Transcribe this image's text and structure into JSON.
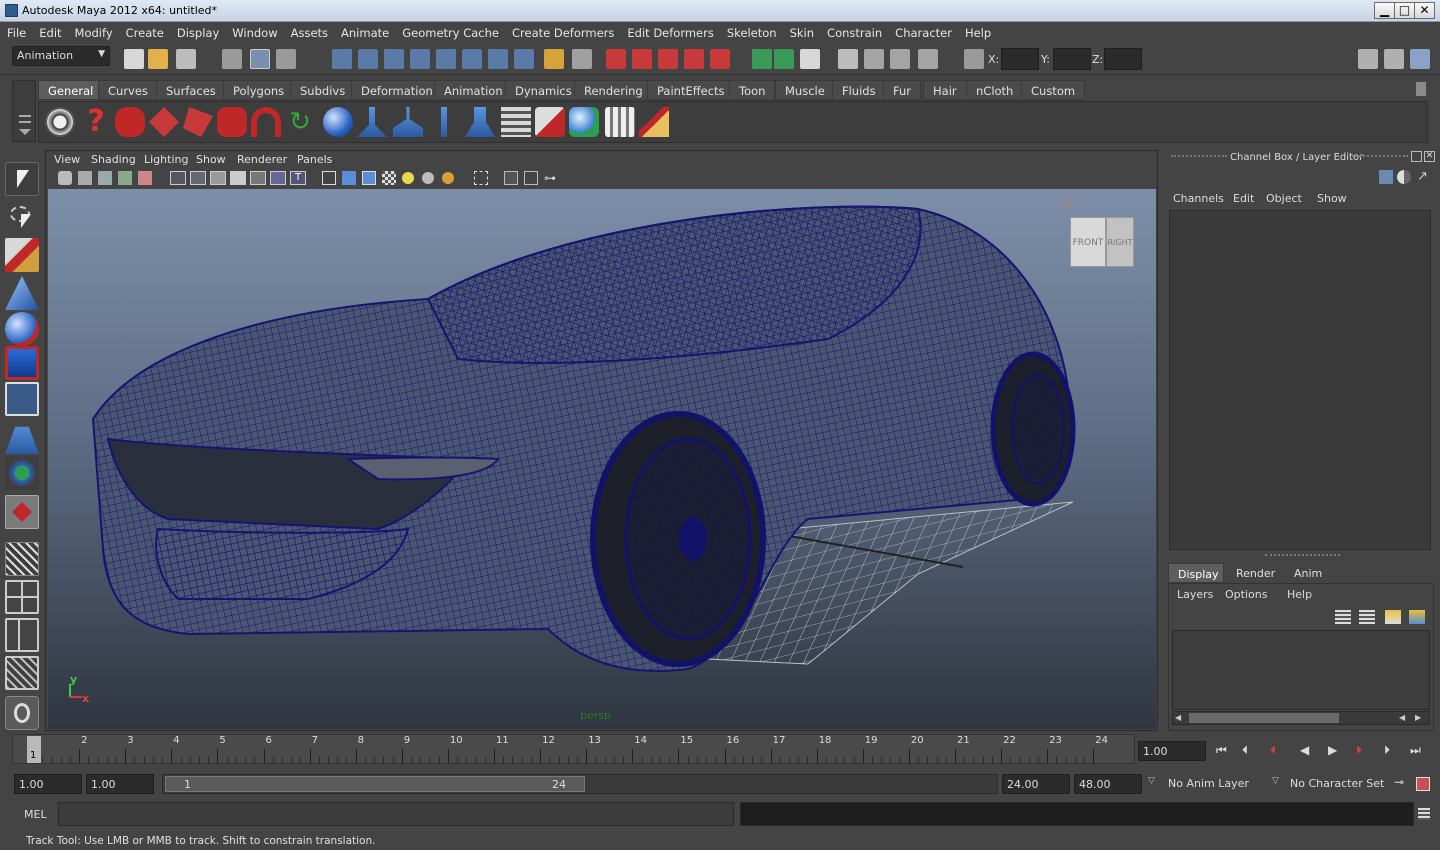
{
  "window": {
    "title": "Autodesk Maya 2012 x64: untitled*",
    "minimize_glyph": "▁",
    "maximize_glyph": "□",
    "close_glyph": "✕"
  },
  "menubar": [
    "File",
    "Edit",
    "Modify",
    "Create",
    "Display",
    "Window",
    "Assets",
    "Animate",
    "Geometry Cache",
    "Create Deformers",
    "Edit Deformers",
    "Skeleton",
    "Skin",
    "Constrain",
    "Character",
    "Help"
  ],
  "statusline": {
    "menuset": "Animation",
    "x_label": "X:",
    "y_label": "Y:",
    "z_label": "Z:"
  },
  "shelf": {
    "tabs": [
      "General",
      "Curves",
      "Surfaces",
      "Polygons",
      "Subdivs",
      "Deformation",
      "Animation",
      "Dynamics",
      "Rendering",
      "PaintEffects",
      "Toon",
      "Muscle",
      "Fluids",
      "Fur",
      "Hair",
      "nCloth",
      "Custom"
    ],
    "active_tab": "General"
  },
  "viewport": {
    "menus": [
      "View",
      "Shading",
      "Lighting",
      "Show",
      "Renderer",
      "Panels"
    ],
    "camera_label": "persp",
    "viewcube_front": "FRONT",
    "viewcube_right": "RIGHT",
    "axis_y": "y",
    "axis_x": "x",
    "wire_color": "#1a1a7a"
  },
  "channelbox": {
    "title": "Channel Box / Layer Editor",
    "menus": [
      "Channels",
      "Edit",
      "Object",
      "Show"
    ],
    "layer_tabs": [
      "Display",
      "Render",
      "Anim"
    ],
    "active_layer_tab": "Display",
    "layer_menus": [
      "Layers",
      "Options",
      "Help"
    ]
  },
  "timeline": {
    "ticks": [
      "1",
      "2",
      "3",
      "4",
      "5",
      "6",
      "7",
      "8",
      "9",
      "10",
      "11",
      "12",
      "13",
      "14",
      "15",
      "16",
      "17",
      "18",
      "19",
      "20",
      "21",
      "22",
      "23",
      "24"
    ],
    "current_frame": "1",
    "current_time_field": "1.00"
  },
  "rangebar": {
    "start_time": "1.00",
    "playback_start": "1.00",
    "slider_start": "1",
    "slider_end": "24",
    "playback_end": "24.00",
    "end_time": "48.00",
    "anim_layer": "No Anim Layer",
    "character_set": "No Character Set"
  },
  "cmdline": {
    "language": "MEL"
  },
  "helpline": {
    "text": "Track Tool: Use LMB or MMB to track. Shift to constrain translation."
  },
  "colors": {
    "ui_bg": "#444444",
    "field_bg": "#2b2b2b",
    "playhead": "#cc2222"
  }
}
